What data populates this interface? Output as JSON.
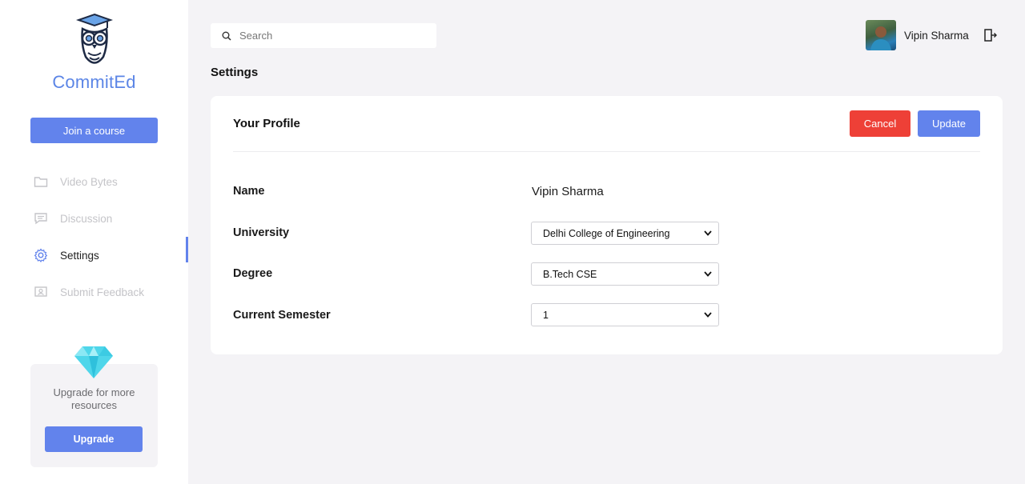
{
  "app": {
    "name": "CommitEd"
  },
  "sidebar": {
    "join_label": "Join a course",
    "items": [
      {
        "label": "Video Bytes",
        "icon": "folder-icon",
        "active": false
      },
      {
        "label": "Discussion",
        "icon": "chat-icon",
        "active": false
      },
      {
        "label": "Settings",
        "icon": "gear-icon",
        "active": true
      },
      {
        "label": "Submit Feedback",
        "icon": "feedback-icon",
        "active": false
      }
    ],
    "upgrade": {
      "text": "Upgrade for more resources",
      "button_label": "Upgrade"
    }
  },
  "topbar": {
    "search_placeholder": "Search",
    "user_name": "Vipin Sharma"
  },
  "page": {
    "title": "Settings"
  },
  "profile": {
    "title": "Your Profile",
    "cancel_label": "Cancel",
    "update_label": "Update",
    "fields": {
      "name": {
        "label": "Name",
        "value": "Vipin Sharma"
      },
      "university": {
        "label": "University",
        "value": "Delhi College of Engineering"
      },
      "degree": {
        "label": "Degree",
        "value": "B.Tech CSE"
      },
      "semester": {
        "label": "Current Semester",
        "value": "1"
      }
    }
  },
  "colors": {
    "accent": "#6283ec",
    "danger": "#ee4037",
    "logo": "#5b85e6",
    "background": "#f4f3f6"
  }
}
